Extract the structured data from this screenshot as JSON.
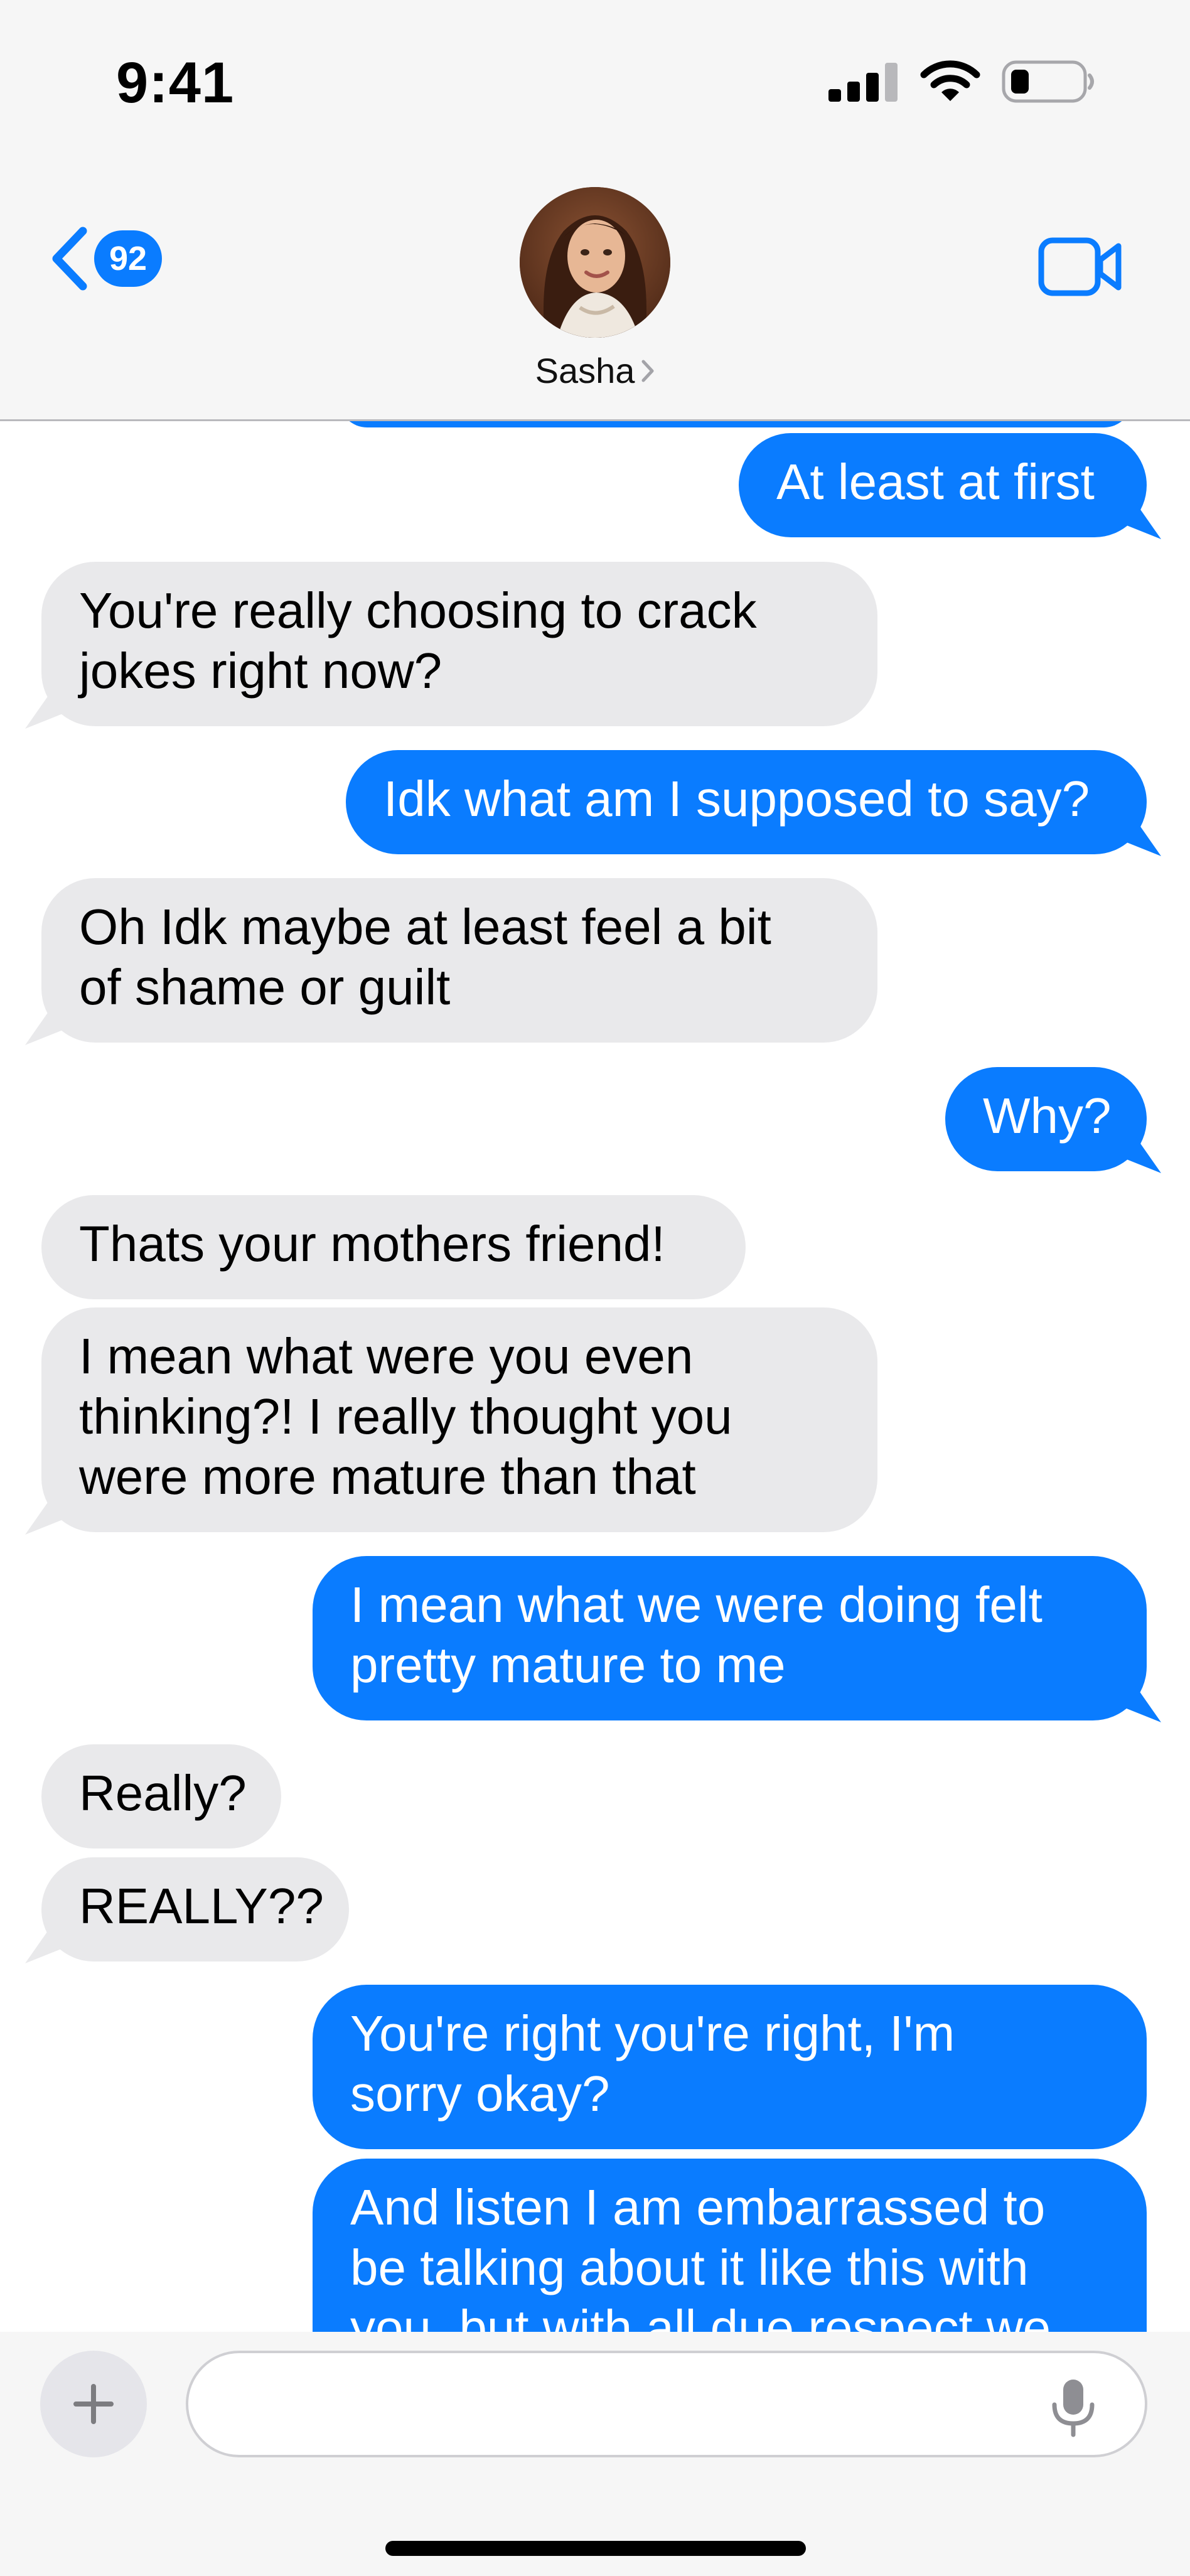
{
  "status_bar": {
    "time": "9:41",
    "icons": [
      "cellular-signal-icon",
      "wifi-icon",
      "battery-icon"
    ]
  },
  "header": {
    "unread_count": "92",
    "contact_name": "Sasha",
    "icons": [
      "chevron-left-icon",
      "chevron-right-icon",
      "video-camera-icon"
    ]
  },
  "colors": {
    "sent_bubble": "#0a7cff",
    "received_bubble": "#e9e9eb",
    "accent": "#0a7cff"
  },
  "messages": [
    {
      "sender": "me",
      "text": "At least at first"
    },
    {
      "sender": "them",
      "text": "You're really choosing to crack\njokes right now?"
    },
    {
      "sender": "me",
      "text": "Idk what am I supposed to say?"
    },
    {
      "sender": "them",
      "text": "Oh Idk maybe at least feel a bit\nof shame or guilt"
    },
    {
      "sender": "me",
      "text": "Why?"
    },
    {
      "sender": "them",
      "text": "Thats your mothers friend!"
    },
    {
      "sender": "them",
      "text": "I mean what were you even\nthinking?! I really thought you\nwere more mature than that"
    },
    {
      "sender": "me",
      "text": "I mean what we were doing felt\npretty mature to me"
    },
    {
      "sender": "them",
      "text": "Really?"
    },
    {
      "sender": "them",
      "text": "REALLY??"
    },
    {
      "sender": "me",
      "text": "You're right you're right, I'm\nsorry okay?"
    },
    {
      "sender": "me",
      "text": "And listen I am embarrassed to\nbe talking about it like this with\nyou, but with all due respect we"
    }
  ],
  "composer": {
    "input_value": "",
    "input_placeholder": "",
    "icons": [
      "plus-icon",
      "microphone-icon"
    ]
  }
}
